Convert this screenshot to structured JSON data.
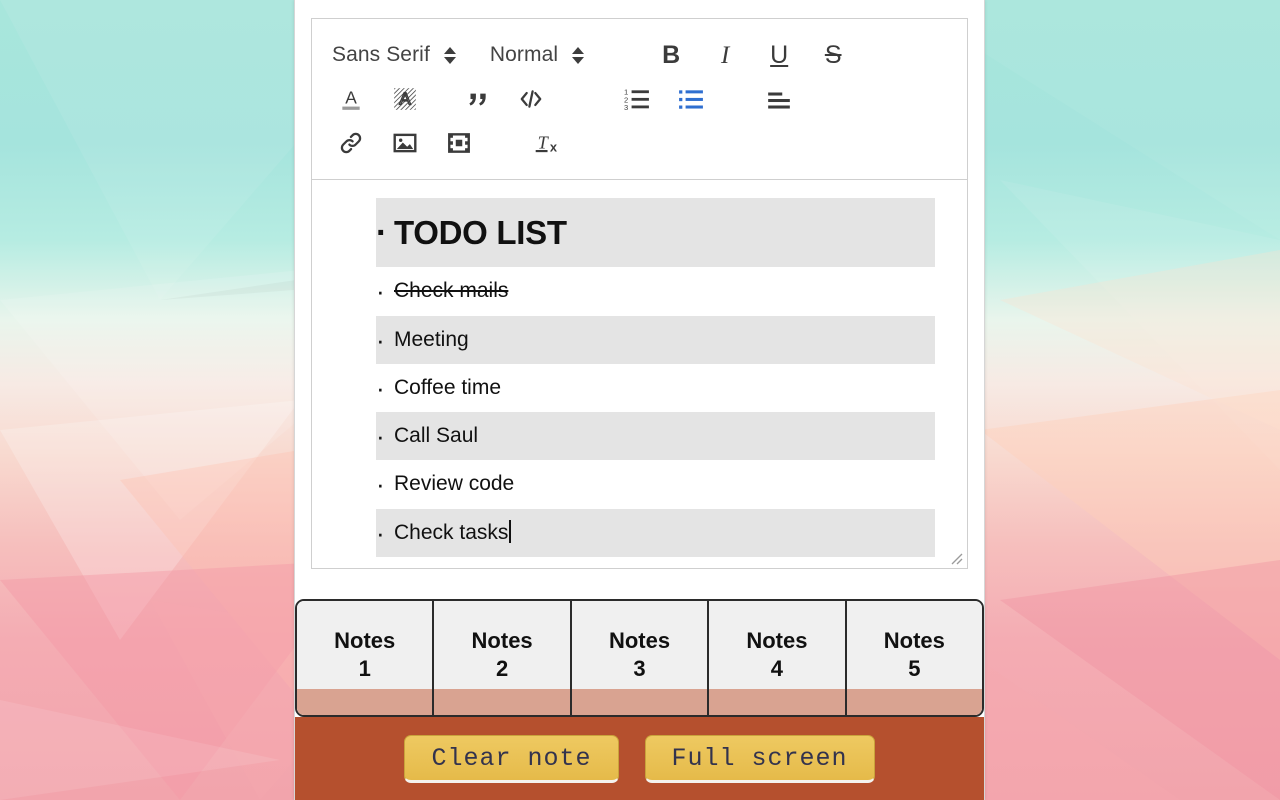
{
  "wallpaper": {
    "top_color": "#a8e6dc",
    "bottom_color": "#f2a4ac"
  },
  "editor": {
    "toolbar": {
      "font_picker": {
        "label": "Sans Serif",
        "icon": "chevron-updown-icon"
      },
      "size_picker": {
        "label": "Normal",
        "icon": "chevron-updown-icon"
      },
      "bold_label": "B",
      "italic_label": "I",
      "underline_label": "U",
      "strike_label": "S",
      "buttons": [
        {
          "name": "text-color-icon",
          "title": "Text color"
        },
        {
          "name": "background-color-icon",
          "title": "Background color"
        },
        {
          "name": "blockquote-icon",
          "title": "Blockquote"
        },
        {
          "name": "code-block-icon",
          "title": "Code block"
        },
        {
          "name": "ordered-list-icon",
          "title": "Ordered list"
        },
        {
          "name": "bullet-list-icon",
          "title": "Bullet list"
        },
        {
          "name": "align-icon",
          "title": "Align"
        },
        {
          "name": "link-icon",
          "title": "Link"
        },
        {
          "name": "image-icon",
          "title": "Image"
        },
        {
          "name": "video-icon",
          "title": "Video"
        },
        {
          "name": "clear-format-icon",
          "title": "Clear formatting"
        }
      ],
      "active_button": "bullet-list-icon",
      "active_color": "#2f6fd0"
    },
    "content": {
      "items": [
        {
          "text": "TODO LIST",
          "heading": true,
          "struck": false,
          "shaded": true
        },
        {
          "text": "Check mails",
          "heading": false,
          "struck": true,
          "shaded": false
        },
        {
          "text": "Meeting",
          "heading": false,
          "struck": false,
          "shaded": true
        },
        {
          "text": "Coffee time",
          "heading": false,
          "struck": false,
          "shaded": false
        },
        {
          "text": "Call Saul",
          "heading": false,
          "struck": false,
          "shaded": true
        },
        {
          "text": "Review code",
          "heading": false,
          "struck": false,
          "shaded": false
        },
        {
          "text": "Check tasks",
          "heading": false,
          "struck": false,
          "shaded": true,
          "caret": true
        }
      ],
      "shade_color": "#e4e4e4"
    },
    "resize_handle": "resize-grip-icon"
  },
  "tabs": [
    {
      "label": "Notes",
      "index": "1"
    },
    {
      "label": "Notes",
      "index": "2"
    },
    {
      "label": "Notes",
      "index": "3"
    },
    {
      "label": "Notes",
      "index": "4"
    },
    {
      "label": "Notes",
      "index": "5"
    }
  ],
  "tab_strip": {
    "underbar_color": "#d9a391"
  },
  "footer": {
    "background": "#b5502e",
    "clear_note_label": "Clear note",
    "full_screen_label": "Full screen",
    "button_color": "#e8c15a"
  }
}
